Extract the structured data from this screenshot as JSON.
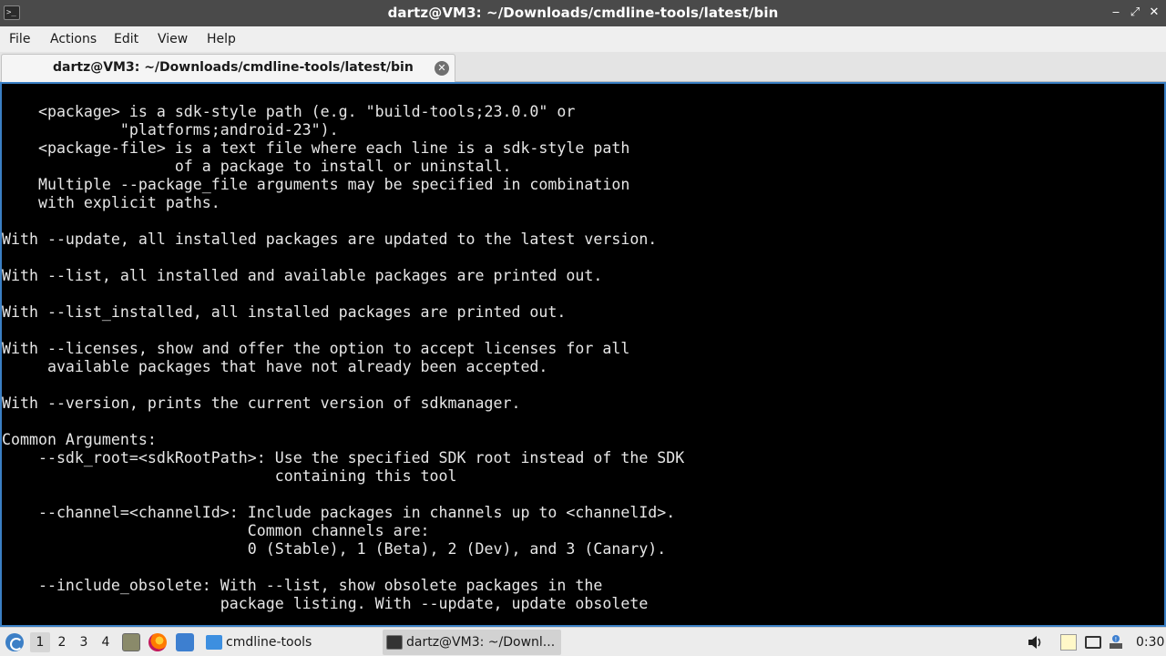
{
  "window": {
    "title": "dartz@VM3: ~/Downloads/cmdline-tools/latest/bin",
    "app_icon_glyph": ">_",
    "minimize_glyph": "‒",
    "maximize_glyph": "⤢",
    "close_glyph": "✕"
  },
  "menu": [
    "File",
    "Actions",
    "Edit",
    "View",
    "Help"
  ],
  "tab": {
    "label": "dartz@VM3: ~/Downloads/cmdline-tools/latest/bin",
    "close_glyph": "✕"
  },
  "terminal": {
    "lines": [
      "    <package> is a sdk-style path (e.g. \"build-tools;23.0.0\" or",
      "             \"platforms;android-23\").",
      "    <package-file> is a text file where each line is a sdk-style path",
      "                   of a package to install or uninstall.",
      "    Multiple --package_file arguments may be specified in combination",
      "    with explicit paths.",
      "",
      "With --update, all installed packages are updated to the latest version.",
      "",
      "With --list, all installed and available packages are printed out.",
      "",
      "With --list_installed, all installed packages are printed out.",
      "",
      "With --licenses, show and offer the option to accept licenses for all",
      "     available packages that have not already been accepted.",
      "",
      "With --version, prints the current version of sdkmanager.",
      "",
      "Common Arguments:",
      "    --sdk_root=<sdkRootPath>: Use the specified SDK root instead of the SDK",
      "                              containing this tool",
      "",
      "    --channel=<channelId>: Include packages in channels up to <channelId>.",
      "                           Common channels are:",
      "                           0 (Stable), 1 (Beta), 2 (Dev), and 3 (Canary).",
      "",
      "    --include_obsolete: With --list, show obsolete packages in the",
      "                        package listing. With --update, update obsolete"
    ]
  },
  "taskbar": {
    "desktops": [
      "1",
      "2",
      "3",
      "4"
    ],
    "active_desktop": "1",
    "tasks": [
      {
        "label": "cmdline-tools",
        "icon": "folder-icon"
      },
      {
        "label": "dartz@VM3: ~/Downl...",
        "icon": "terminal-icon"
      }
    ],
    "clock": "0:30"
  },
  "colors": {
    "titlebar": "#4a4a4a",
    "terminal_bg": "#000000",
    "terminal_fg": "#e6e6e6",
    "terminal_border": "#3a7fc4"
  }
}
